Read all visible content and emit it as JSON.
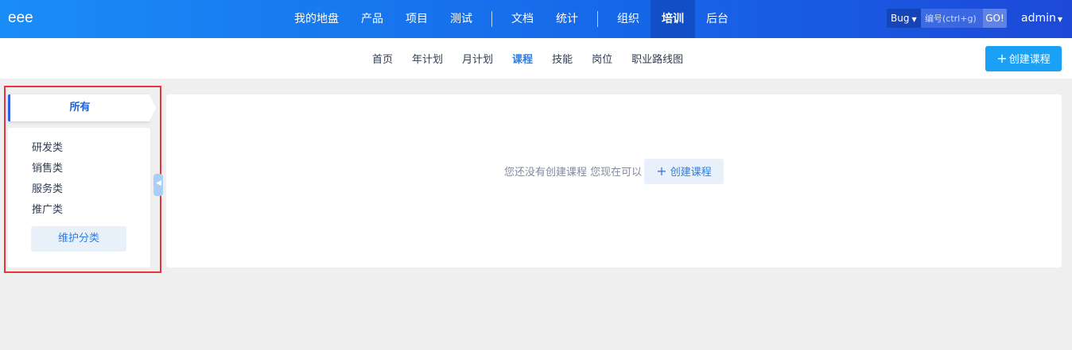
{
  "brand": "eee",
  "main_nav": [
    {
      "label": "我的地盘",
      "active": false
    },
    {
      "label": "产品",
      "active": false
    },
    {
      "label": "项目",
      "active": false
    },
    {
      "label": "测试",
      "active": false
    },
    {
      "label": "文档",
      "active": false
    },
    {
      "label": "统计",
      "active": false
    },
    {
      "label": "组织",
      "active": false
    },
    {
      "label": "培训",
      "active": true
    },
    {
      "label": "后台",
      "active": false
    }
  ],
  "search": {
    "type": "Bug",
    "placeholder": "编号(ctrl+g)",
    "go_label": "GO!"
  },
  "user": {
    "name": "admin"
  },
  "sub_nav": [
    {
      "label": "首页",
      "active": false
    },
    {
      "label": "年计划",
      "active": false
    },
    {
      "label": "月计划",
      "active": false
    },
    {
      "label": "课程",
      "active": true
    },
    {
      "label": "技能",
      "active": false
    },
    {
      "label": "岗位",
      "active": false
    },
    {
      "label": "职业路线图",
      "active": false
    }
  ],
  "create_button": "创建课程",
  "sidebar": {
    "all_label": "所有",
    "categories": [
      "研发类",
      "销售类",
      "服务类",
      "推广类"
    ],
    "maintain_label": "维护分类"
  },
  "empty_state": {
    "message": "您还没有创建课程 您现在可以",
    "action_label": "创建课程"
  },
  "colors": {
    "accent": "#1aa0f5",
    "active_link": "#2e7de4",
    "highlight_border": "#e8343a"
  }
}
